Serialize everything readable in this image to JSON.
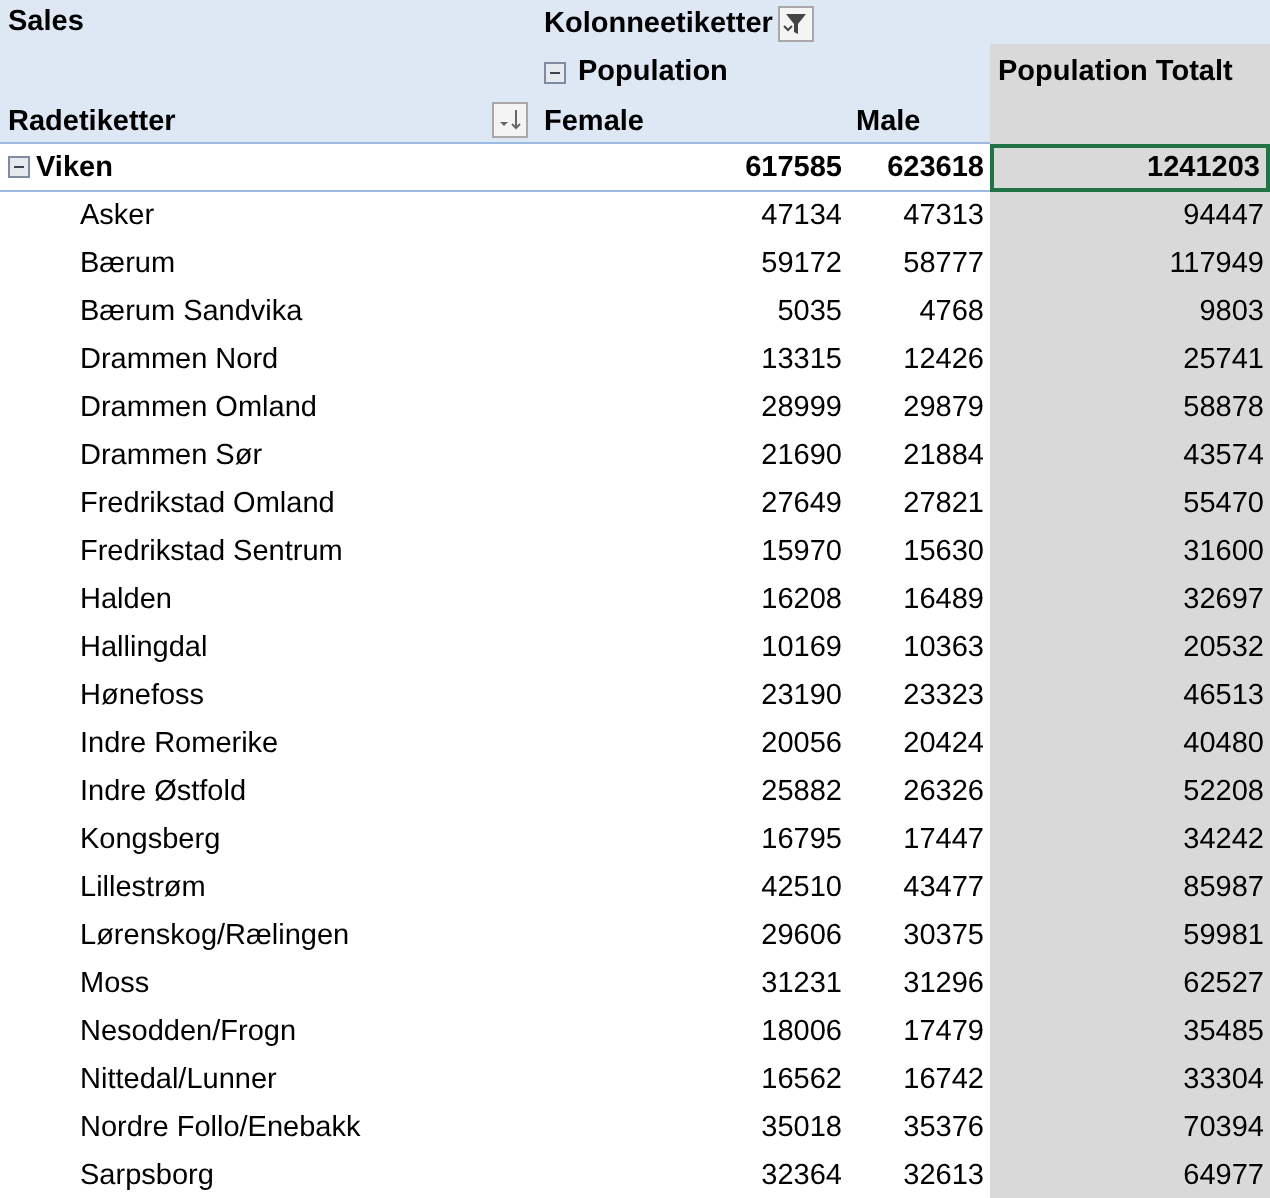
{
  "header": {
    "values_label": "Sales",
    "column_labels": "Kolonneetiketter",
    "field": "Population",
    "field_expanded": true,
    "grand_total": "Population Totalt",
    "row_labels": "Radetiketter",
    "columns": [
      "Female",
      "Male"
    ]
  },
  "groups": [
    {
      "name": "Viken",
      "expanded": true,
      "female": "617585",
      "male": "623618",
      "total": "1241203",
      "total_selected": true,
      "rows": [
        {
          "name": "Asker",
          "female": "47134",
          "male": "47313",
          "total": "94447"
        },
        {
          "name": "Bærum",
          "female": "59172",
          "male": "58777",
          "total": "117949"
        },
        {
          "name": "Bærum Sandvika",
          "female": "5035",
          "male": "4768",
          "total": "9803"
        },
        {
          "name": "Drammen Nord",
          "female": "13315",
          "male": "12426",
          "total": "25741"
        },
        {
          "name": "Drammen Omland",
          "female": "28999",
          "male": "29879",
          "total": "58878"
        },
        {
          "name": "Drammen Sør",
          "female": "21690",
          "male": "21884",
          "total": "43574"
        },
        {
          "name": "Fredrikstad Omland",
          "female": "27649",
          "male": "27821",
          "total": "55470"
        },
        {
          "name": "Fredrikstad Sentrum",
          "female": "15970",
          "male": "15630",
          "total": "31600"
        },
        {
          "name": "Halden",
          "female": "16208",
          "male": "16489",
          "total": "32697"
        },
        {
          "name": "Hallingdal",
          "female": "10169",
          "male": "10363",
          "total": "20532"
        },
        {
          "name": "Hønefoss",
          "female": "23190",
          "male": "23323",
          "total": "46513"
        },
        {
          "name": "Indre Romerike",
          "female": "20056",
          "male": "20424",
          "total": "40480"
        },
        {
          "name": "Indre Østfold",
          "female": "25882",
          "male": "26326",
          "total": "52208"
        },
        {
          "name": "Kongsberg",
          "female": "16795",
          "male": "17447",
          "total": "34242"
        },
        {
          "name": "Lillestrøm",
          "female": "42510",
          "male": "43477",
          "total": "85987"
        },
        {
          "name": "Lørenskog/Rælingen",
          "female": "29606",
          "male": "30375",
          "total": "59981"
        },
        {
          "name": "Moss",
          "female": "31231",
          "male": "31296",
          "total": "62527"
        },
        {
          "name": "Nesodden/Frogn",
          "female": "18006",
          "male": "17479",
          "total": "35485"
        },
        {
          "name": "Nittedal/Lunner",
          "female": "16562",
          "male": "16742",
          "total": "33304"
        },
        {
          "name": "Nordre Follo/Enebakk",
          "female": "35018",
          "male": "35376",
          "total": "70394"
        },
        {
          "name": "Sarpsborg",
          "female": "32364",
          "male": "32613",
          "total": "64977"
        }
      ]
    }
  ]
}
